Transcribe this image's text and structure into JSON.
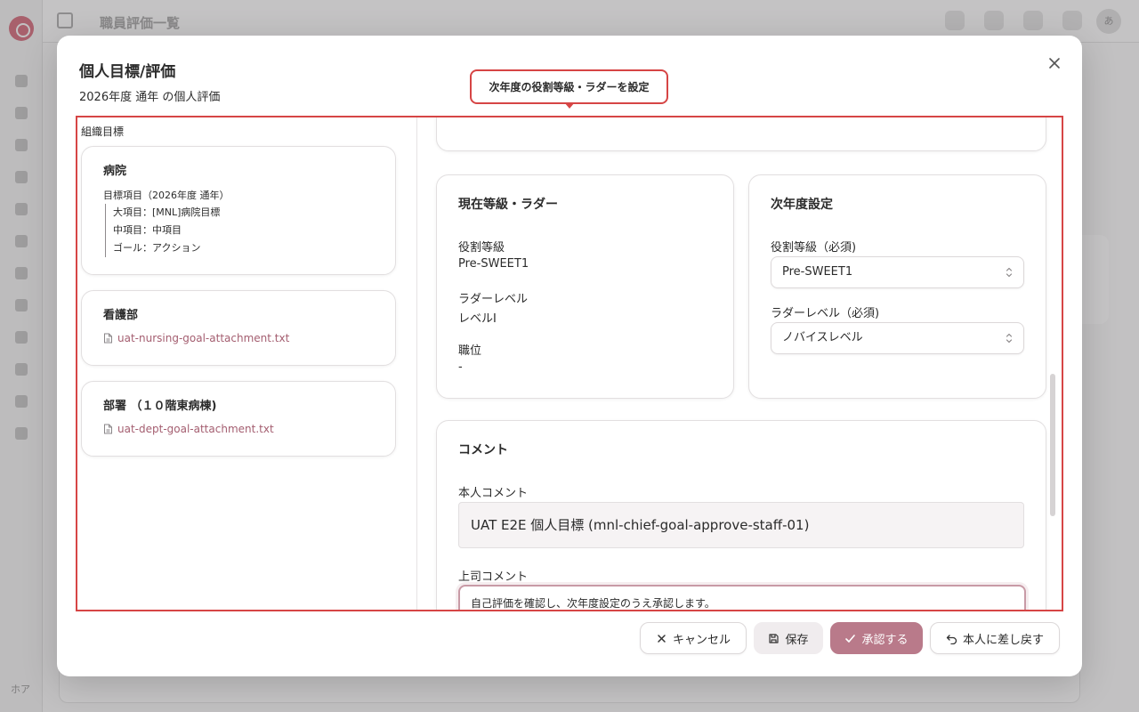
{
  "background": {
    "header_title": "職員評価一覧",
    "avatar_initial": "あ",
    "sidebar_footer": "ホア"
  },
  "modal": {
    "title": "個人目標/評価",
    "subtitle": "2026年度 通年 の個人評価"
  },
  "callout": {
    "text": "次年度の役割等級・ラダーを設定"
  },
  "org_goals": {
    "section_label": "組織目標",
    "hospital": {
      "title": "病院",
      "item_head": "目標項目（2026年度 通年）",
      "major": "大項目：[MNL]病院目標",
      "middle": "中項目：中項目",
      "goal": "ゴール：アクション"
    },
    "nursing": {
      "title": "看護部",
      "attachment": "uat-nursing-goal-attachment.txt"
    },
    "department": {
      "title": "部署 （１０階東病棟)",
      "attachment": "uat-dept-goal-attachment.txt"
    }
  },
  "current": {
    "title": "現在等級・ラダー",
    "role_grade_label": "役割等級",
    "role_grade_value": "Pre-SWEET1",
    "ladder_label": "ラダーレベル",
    "ladder_value": "レベルⅠ",
    "position_label": "職位",
    "position_value": "-"
  },
  "next_year": {
    "title": "次年度設定",
    "role_grade_label": "役割等級（必須)",
    "role_grade_selected": "Pre-SWEET1",
    "ladder_label": "ラダーレベル（必須)",
    "ladder_selected": "ノバイスレベル"
  },
  "comments": {
    "title": "コメント",
    "self_label": "本人コメント",
    "self_value": "UAT E2E 個人目標 (mnl-chief-goal-approve-staff-01)",
    "boss_label": "上司コメント",
    "boss_value": "自己評価を確認し、次年度設定のうえ承認します。"
  },
  "footer": {
    "cancel": "キャンセル",
    "save": "保存",
    "approve": "承認する",
    "return": "本人に差し戻す"
  },
  "colors": {
    "accent": "#b97a8a",
    "highlight_border": "#d64545",
    "link": "#a45e70"
  }
}
